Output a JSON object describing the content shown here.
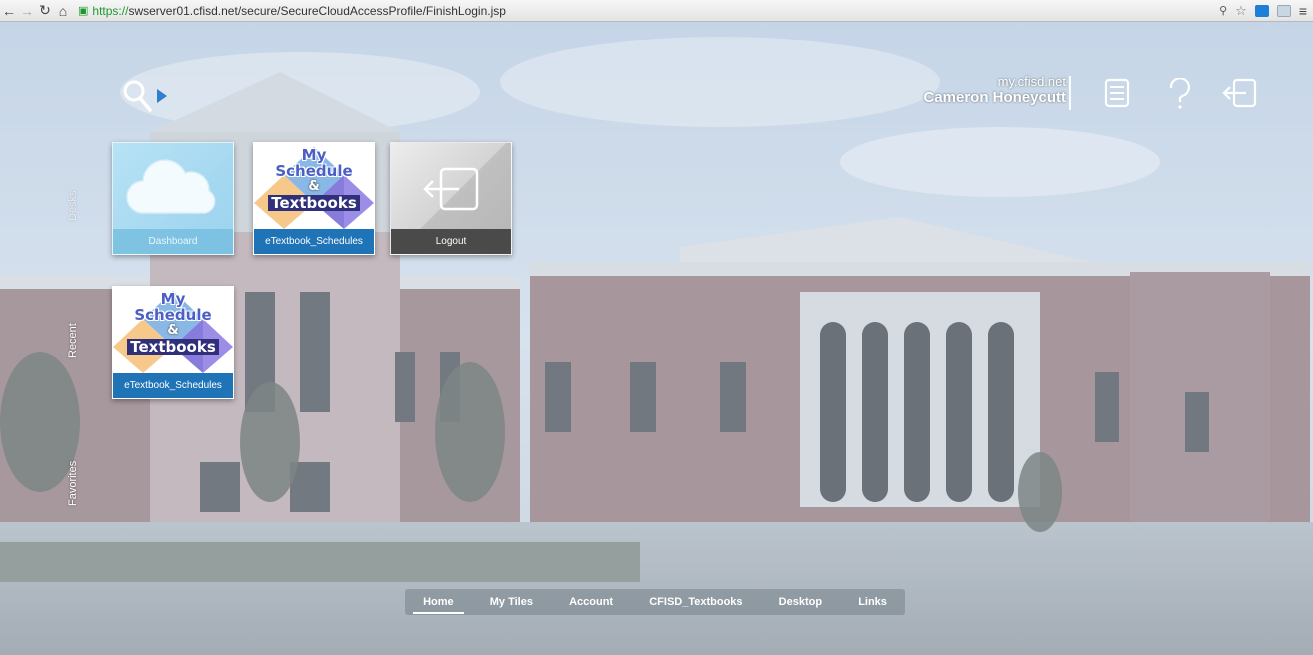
{
  "browser": {
    "url_protocol": "https://",
    "url_rest": "swserver01.cfisd.net/secure/SecureCloudAccessProfile/FinishLogin.jsp"
  },
  "header": {
    "site": "my.cfisd.net",
    "user_name": "Cameron Honeycutt"
  },
  "side_nav": {
    "top": "Desks",
    "recent": "Recent",
    "favorites": "Favorites"
  },
  "tiles": [
    {
      "caption": "Dashboard"
    },
    {
      "caption": "eTextbook_Schedules",
      "art_line1": "My",
      "art_line2": "Schedule",
      "art_amp": "&",
      "art_line3": "Textbooks"
    },
    {
      "caption": "Logout"
    }
  ],
  "recent_tiles": [
    {
      "caption": "eTextbook_Schedules",
      "art_line1": "My",
      "art_line2": "Schedule",
      "art_amp": "&",
      "art_line3": "Textbooks"
    }
  ],
  "bottom_nav": {
    "items": [
      {
        "label": "Home"
      },
      {
        "label": "My Tiles"
      },
      {
        "label": "Account"
      },
      {
        "label": "CFISD_Textbooks"
      },
      {
        "label": "Desktop"
      },
      {
        "label": "Links"
      }
    ],
    "active_index": 0
  },
  "colors": {
    "accent_blue": "#1f73b7",
    "dashboard_tile": "#9ad2ee",
    "logout_caption": "#4a4a4a"
  }
}
